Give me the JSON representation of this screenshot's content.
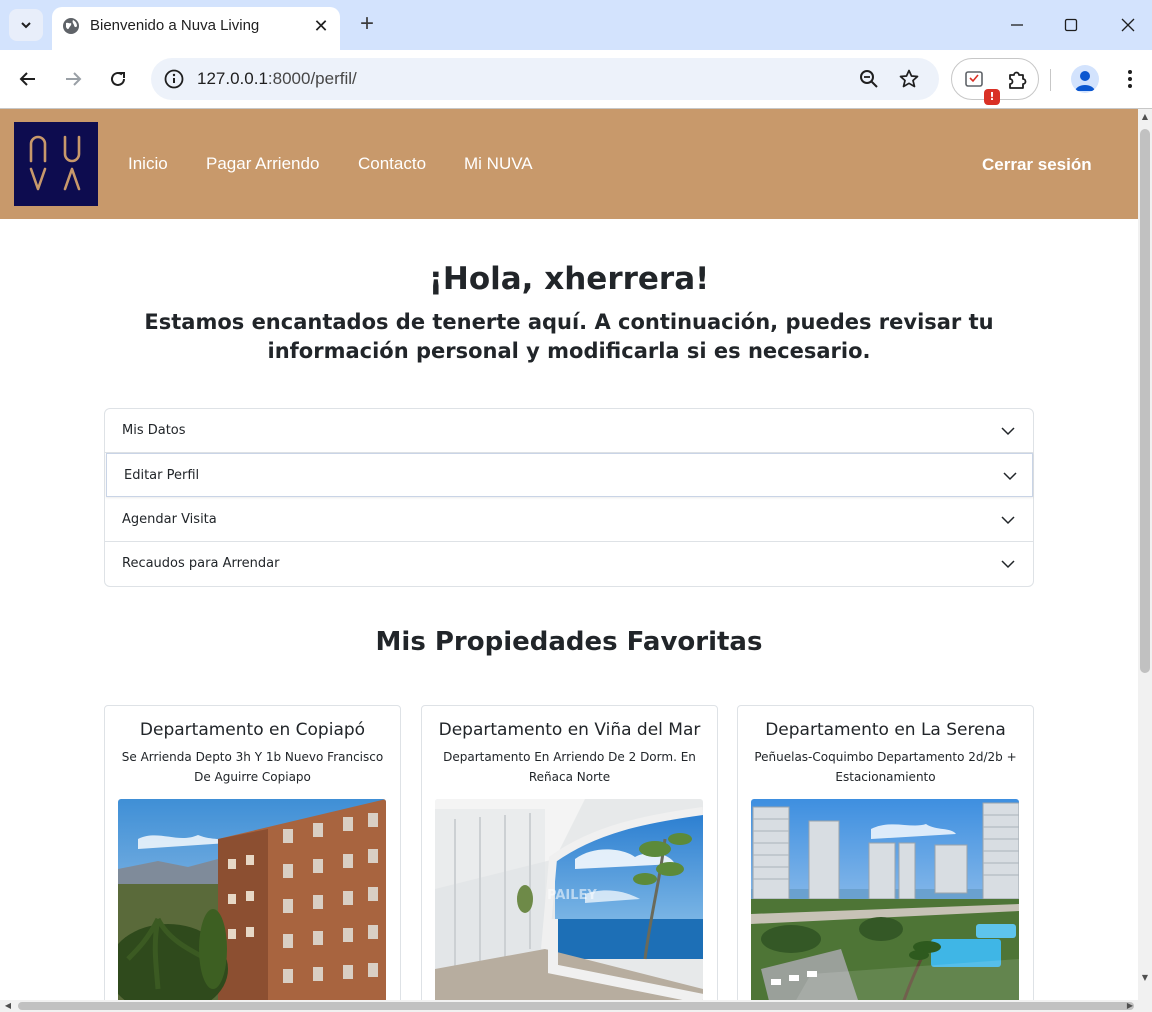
{
  "browser": {
    "tab_title": "Bienvenido a Nuva Living",
    "tab_close": "✕",
    "new_tab": "+",
    "url_host": "127.0.0.1",
    "url_path": ":8000/perfil/",
    "ext_badge": "!"
  },
  "site": {
    "logo_text": "NUVA",
    "nav": [
      "Inicio",
      "Pagar Arriendo",
      "Contacto",
      "Mi NUVA"
    ],
    "logout": "Cerrar sesión",
    "accent": "#c8996b",
    "logo_bg": "#0d0c4f"
  },
  "greeting": {
    "title": "¡Hola, xherrera!",
    "subtitle": "Estamos encantados de tenerte aquí. A continuación, puedes revisar tu información personal y modificarla si es necesario."
  },
  "accordion": [
    "Mis Datos",
    "Editar Perfil",
    "Agendar Visita",
    "Recaudos para Arrendar"
  ],
  "favorites": {
    "title": "Mis Propiedades Favoritas",
    "cards": [
      {
        "title": "Departamento en Copiapó",
        "desc": "Se Arrienda Depto 3h Y 1b Nuevo Francisco De Aguirre Copiapo"
      },
      {
        "title": "Departamento en Viña del Mar",
        "desc": "Departamento En Arriendo De 2 Dorm. En Reñaca Norte",
        "watermark": "PAILEY"
      },
      {
        "title": "Departamento en La Serena",
        "desc": "Peñuelas-Coquimbo Departamento 2d/2b + Estacionamiento"
      }
    ]
  }
}
